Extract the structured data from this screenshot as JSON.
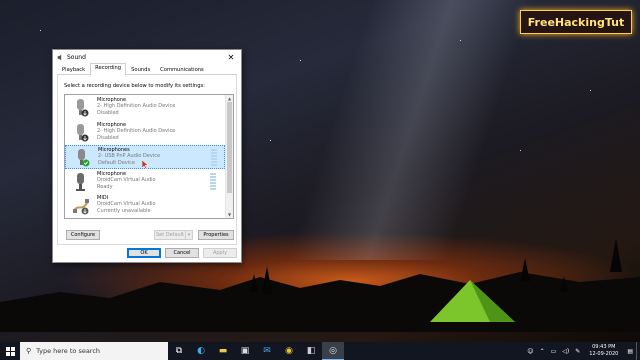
{
  "watermark": "FreeHackingTut",
  "dialog": {
    "title": "Sound",
    "tabs": [
      "Playback",
      "Recording",
      "Sounds",
      "Communications"
    ],
    "active_tab": "Recording",
    "hint": "Select a recording device below to modify its settings:",
    "devices": [
      {
        "name": "Microphone",
        "device": "2- High Definition Audio Device",
        "status": "Disabled",
        "icon": "microphone-disabled-icon",
        "selected": false
      },
      {
        "name": "Microphone",
        "device": "2- High Definition Audio Device",
        "status": "Disabled",
        "icon": "microphone-disabled-icon",
        "selected": false
      },
      {
        "name": "Microphones",
        "device": "2- USB PnP Audio Device",
        "status": "Default Device",
        "icon": "microphone-default-icon",
        "selected": true
      },
      {
        "name": "Microphone",
        "device": "DroidCam Virtual Audio",
        "status": "Ready",
        "icon": "microphone-icon",
        "selected": false
      },
      {
        "name": "MIDI",
        "device": "DroidCam Virtual Audio",
        "status": "Currently unavailable",
        "icon": "midi-cable-icon",
        "selected": false
      }
    ],
    "buttons": {
      "configure": "Configure",
      "set_default": "Set Default",
      "properties": "Properties",
      "ok": "OK",
      "cancel": "Cancel",
      "apply": "Apply"
    }
  },
  "taskbar": {
    "search_placeholder": "Type here to search",
    "pinned_icons": [
      "task-view-icon",
      "edge-icon",
      "file-explorer-icon",
      "store-icon",
      "mail-icon",
      "chrome-icon",
      "app-icon",
      "sound-settings-icon"
    ],
    "time": "09:43 PM",
    "date": "12-09-2020"
  }
}
